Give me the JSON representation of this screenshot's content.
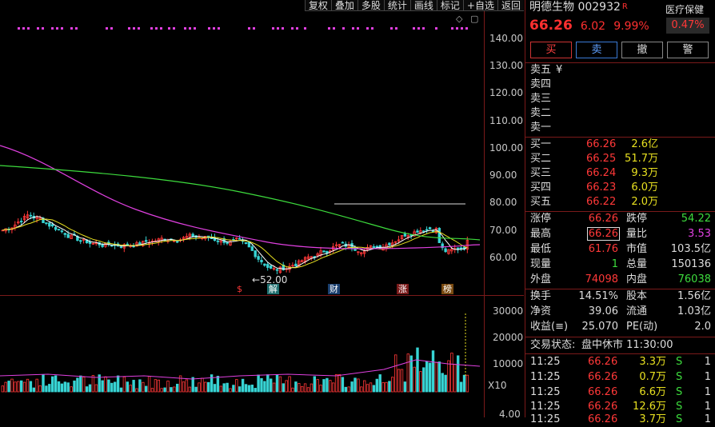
{
  "toolbar": [
    "复权",
    "叠加",
    "多股",
    "统计",
    "画线",
    "标记",
    "+自选",
    "返回"
  ],
  "y_ticks": [
    "140.00",
    "130.00",
    "120.00",
    "110.00",
    "100.00",
    "90.00",
    "80.00",
    "70.00",
    "60.00"
  ],
  "vol_ticks": [
    "30000",
    "20000",
    "10000"
  ],
  "vol_unit": "X10",
  "vol_bottom_tick": "4.00",
  "low_marker": "52.00",
  "badges": [
    "$",
    "解",
    "财",
    "涨",
    "榜"
  ],
  "quote": {
    "name": "明德生物",
    "code": "002932",
    "flag": "R",
    "sector": "医疗保健",
    "sector_change": "0.47%",
    "price": "66.26",
    "change": "6.02",
    "change_pct": "9.99%",
    "buttons": [
      "买",
      "卖",
      "撤",
      "警"
    ],
    "asks": [
      {
        "label": "卖五",
        "price": "¥",
        "vol": ""
      },
      {
        "label": "卖四",
        "price": "",
        "vol": ""
      },
      {
        "label": "卖三",
        "price": "",
        "vol": ""
      },
      {
        "label": "卖二",
        "price": "",
        "vol": ""
      },
      {
        "label": "卖一",
        "price": "",
        "vol": ""
      }
    ],
    "bids": [
      {
        "label": "买一",
        "price": "66.26",
        "vol": "2.6亿"
      },
      {
        "label": "买二",
        "price": "66.25",
        "vol": "51.7万"
      },
      {
        "label": "买三",
        "price": "66.24",
        "vol": "9.3万"
      },
      {
        "label": "买四",
        "price": "66.23",
        "vol": "6.0万"
      },
      {
        "label": "买五",
        "price": "66.22",
        "vol": "2.0万"
      }
    ],
    "stats": {
      "zhangting_l": "涨停",
      "zhangting": "66.26",
      "dieting_l": "跌停",
      "dieting": "54.22",
      "zuigao_l": "最高",
      "zuigao": "66.26",
      "liangbi_l": "量比",
      "liangbi": "3.53",
      "zuidi_l": "最低",
      "zuidi": "61.76",
      "shizhi_l": "市值",
      "shizhi": "103.5亿",
      "xianliang_l": "现量",
      "xianliang": "1",
      "zongliang_l": "总量",
      "zongliang": "150136",
      "waipan_l": "外盘",
      "waipan": "74098",
      "neipan_l": "内盘",
      "neipan": "76038",
      "huanshou_l": "换手",
      "huanshou": "14.51%",
      "guben_l": "股本",
      "guben": "1.56亿",
      "jingzi_l": "净资",
      "jingzi": "39.06",
      "liutong_l": "流通",
      "liutong": "1.03亿",
      "shouyi_l": "收益(≡)",
      "shouyi": "25.070",
      "pe_l": "PE(动)",
      "pe": "2.0"
    },
    "trade_status_label": "交易状态:",
    "trade_status": "盘中休市 11:30:00",
    "ticks": [
      {
        "time": "11:25",
        "price": "66.26",
        "vol": "3.3万",
        "side": "S",
        "n": "1"
      },
      {
        "time": "11:25",
        "price": "66.26",
        "vol": "0.7万",
        "side": "S",
        "n": "1"
      },
      {
        "time": "11:25",
        "price": "66.26",
        "vol": "6.6万",
        "side": "S",
        "n": "1"
      },
      {
        "time": "11:25",
        "price": "66.26",
        "vol": "12.6万",
        "side": "S",
        "n": "1"
      },
      {
        "time": "11:25",
        "price": "66.26",
        "vol": "3.7万",
        "side": "S",
        "n": "1"
      }
    ]
  },
  "colors": {
    "up": "#ff3838",
    "down": "#37d4d4",
    "ma5": "#ffffff",
    "ma10": "#e8e020",
    "ma20": "#e040e0",
    "ma60": "#3ddc3d"
  }
}
